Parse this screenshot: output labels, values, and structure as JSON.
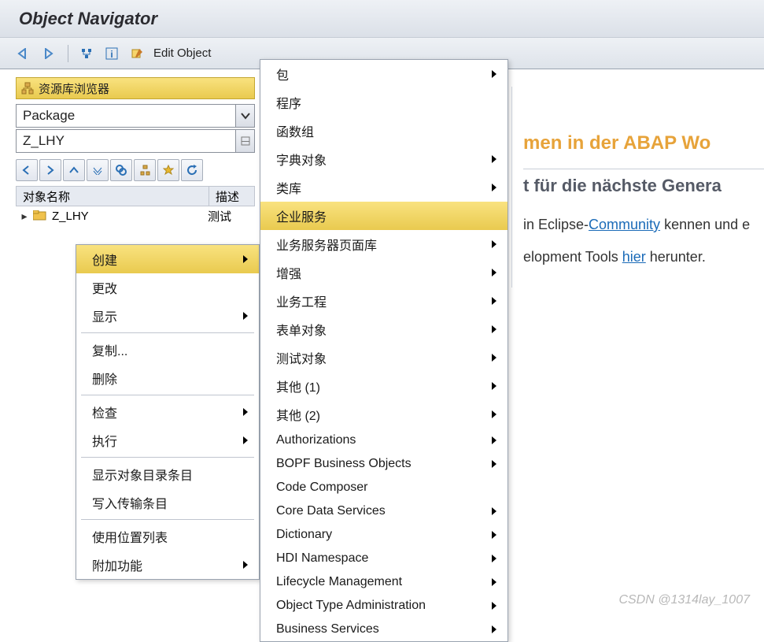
{
  "title": "Object Navigator",
  "toolbar": {
    "edit_label": "Edit Object"
  },
  "browser": {
    "header": "资源库浏览器"
  },
  "selector": {
    "type": "Package",
    "value": "Z_LHY"
  },
  "tree": {
    "col_name": "对象名称",
    "col_desc": "描述",
    "row0": {
      "label": "Z_LHY",
      "desc": "测试"
    }
  },
  "context_menu_1": {
    "create": "创建",
    "change": "更改",
    "display": "显示",
    "copy": "复制...",
    "delete": "删除",
    "check": "检查",
    "execute": "执行",
    "show_dir": "显示对象目录条目",
    "write_transport": "写入传输条目",
    "where_used": "使用位置列表",
    "additional": "附加功能"
  },
  "context_menu_2": {
    "package": "包",
    "program": "程序",
    "function_group": "函数组",
    "dict_obj": "字典对象",
    "class_lib": "类库",
    "enterprise_svc": "企业服务",
    "bsp_lib": "业务服务器页面库",
    "enhancement": "增强",
    "business_eng": "业务工程",
    "form_obj": "表单对象",
    "test_obj": "测试对象",
    "other1": "其他 (1)",
    "other2": "其他 (2)",
    "auth": "Authorizations",
    "bopf": "BOPF Business Objects",
    "code_composer": "Code Composer",
    "cds": "Core Data Services",
    "dictionary": "Dictionary",
    "hdi": "HDI Namespace",
    "lifecycle": "Lifecycle Management",
    "obj_type_admin": "Object Type Administration",
    "business_services": "Business Services"
  },
  "right": {
    "heading1": "men in der ABAP Wo",
    "heading2": "t für die nächste Genera",
    "line1_pre": "in Eclipse-",
    "line1_link": "Community",
    "line1_post": " kennen und e",
    "line2_pre": "elopment Tools ",
    "line2_link": "hier",
    "line2_post": " herunter."
  },
  "watermark": "CSDN @1314lay_1007"
}
